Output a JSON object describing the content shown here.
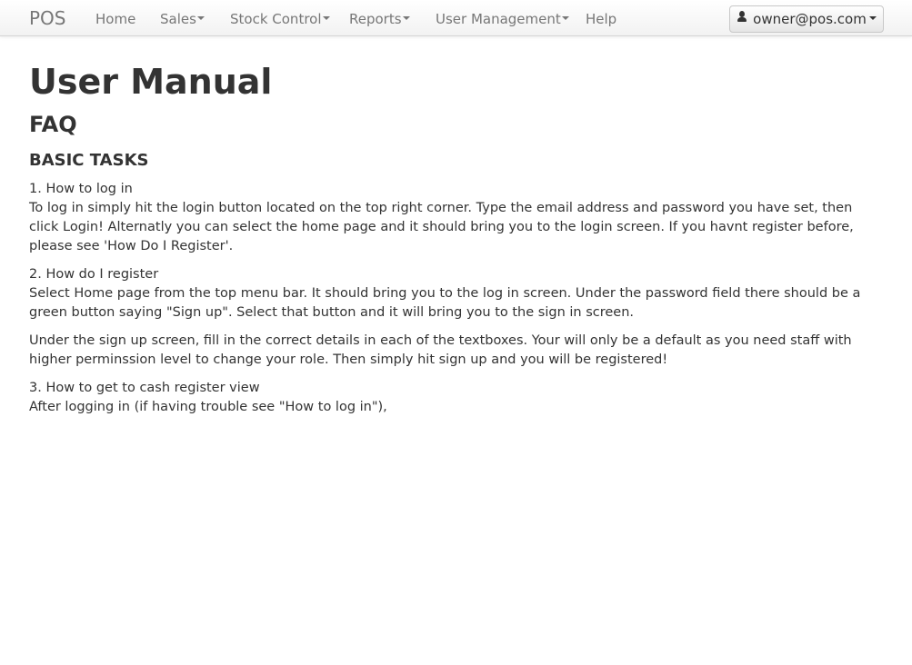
{
  "navbar": {
    "brand": "POS",
    "items": [
      {
        "label": "Home",
        "dropdown": false
      },
      {
        "label": "Sales",
        "dropdown": true
      },
      {
        "label": "Stock Control",
        "dropdown": true
      },
      {
        "label": "Reports",
        "dropdown": true
      },
      {
        "label": "User Management",
        "dropdown": true
      },
      {
        "label": "Help",
        "dropdown": false
      }
    ],
    "user": {
      "email": "owner@pos.com",
      "icon": "user-icon"
    }
  },
  "page": {
    "title": "User Manual",
    "section": "FAQ",
    "subsection": "BASIC TASKS",
    "faqs": [
      {
        "question": "1. How to log in",
        "answer": "To log in simply hit the login button located on the top right corner. Type the email address and password you have set, then click Login! Alternatly you can select the home page and it should bring you to the login screen. If you havnt register before, please see 'How Do I Register'."
      },
      {
        "question": "2. How do I register",
        "answer": "Select Home page from the top menu bar. It should bring you to the log in screen. Under the password field there should be a green button saying \"Sign up\". Select that button and it will bring you to the sign in screen.",
        "extra": "Under the sign up screen, fill in the correct details in each of the textboxes. Your will only be a default as you need staff with higher perminssion level to change your role. Then simply hit sign up and you will be registered!"
      },
      {
        "question": "3. How to get to cash register view",
        "answer": "After logging in (if having trouble see \"How to log in\"),"
      }
    ]
  }
}
